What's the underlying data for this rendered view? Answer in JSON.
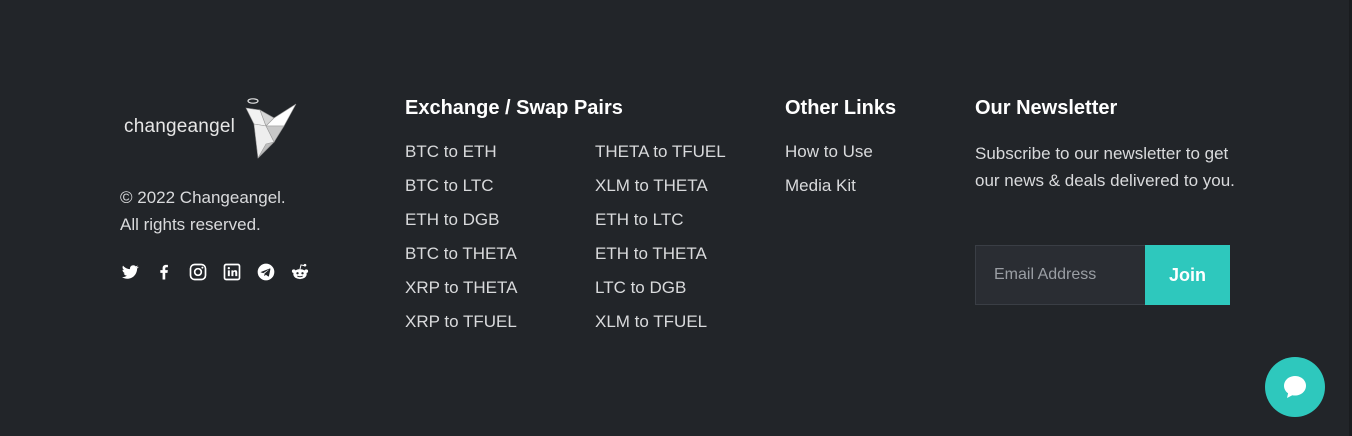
{
  "brand": {
    "logo_text": "changeangel",
    "copyright_line1": "© 2022 Changeangel.",
    "copyright_line2": "All rights reserved."
  },
  "socials": [
    {
      "icon": "twitter-icon"
    },
    {
      "icon": "facebook-icon"
    },
    {
      "icon": "instagram-icon"
    },
    {
      "icon": "linkedin-icon"
    },
    {
      "icon": "telegram-icon"
    },
    {
      "icon": "reddit-icon"
    }
  ],
  "pairs": {
    "title": "Exchange / Swap Pairs",
    "left": [
      "BTC to ETH",
      "BTC to LTC",
      "ETH to DGB",
      "BTC to THETA",
      "XRP to THETA",
      "XRP to TFUEL"
    ],
    "right": [
      "THETA to TFUEL",
      "XLM to THETA",
      "ETH to LTC",
      "ETH to THETA",
      "LTC to DGB",
      "XLM to TFUEL"
    ]
  },
  "other": {
    "title": "Other Links",
    "links": [
      "How to Use",
      "Media Kit"
    ]
  },
  "newsletter": {
    "title": "Our Newsletter",
    "description": "Subscribe to our newsletter to get our news & deals delivered to you.",
    "placeholder": "Email Address",
    "button_label": "Join"
  },
  "colors": {
    "background": "#222529",
    "accent": "#2ec8bd",
    "heading": "#ffffff",
    "text": "#d9dadc"
  }
}
